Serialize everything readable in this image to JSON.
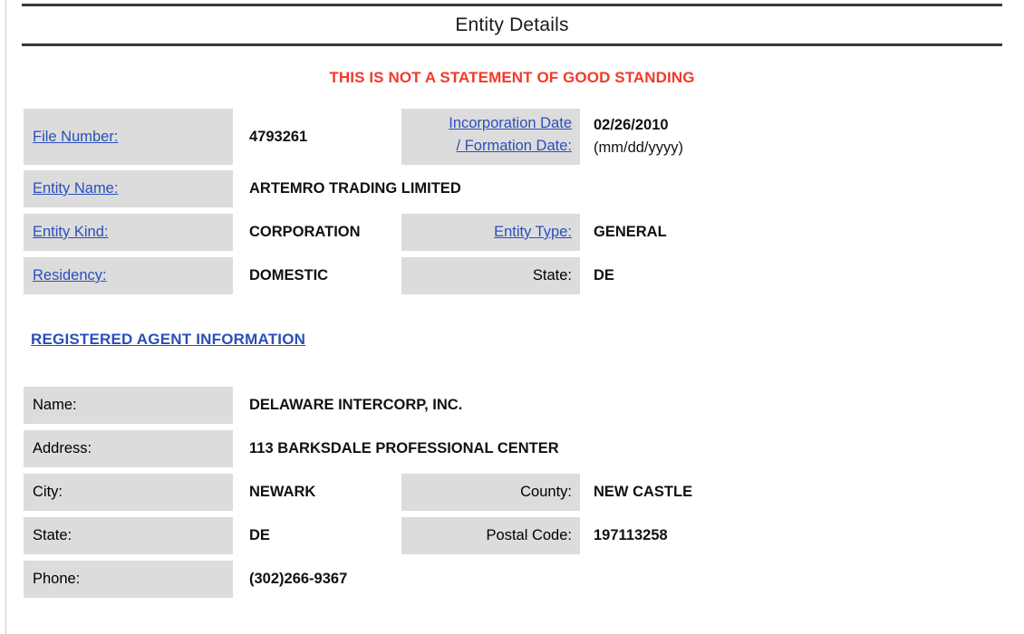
{
  "document": {
    "title": "Entity Details",
    "warning": "THIS IS NOT A STATEMENT OF GOOD STANDING",
    "warning_color": "#f23a28",
    "link_color": "#2a4fbb",
    "label_bg": "#dcdcdc"
  },
  "entity": {
    "file_number": {
      "label": "File Number:",
      "value": "4793261"
    },
    "incorporation_date": {
      "label_line1": "Incorporation Date",
      "label_line2": "/ Formation Date:",
      "value": "02/26/2010",
      "format_hint": "(mm/dd/yyyy)"
    },
    "entity_name": {
      "label": "Entity Name:",
      "value": "ARTEMRO TRADING LIMITED"
    },
    "entity_kind": {
      "label": "Entity Kind:",
      "value": "CORPORATION"
    },
    "entity_type": {
      "label": "Entity Type:",
      "value": "GENERAL"
    },
    "residency": {
      "label": "Residency:",
      "value": "DOMESTIC"
    },
    "state": {
      "label": "State:",
      "value": "DE"
    }
  },
  "registered_agent": {
    "section_title": "REGISTERED AGENT INFORMATION",
    "name": {
      "label": "Name:",
      "value": "DELAWARE INTERCORP, INC."
    },
    "address": {
      "label": "Address:",
      "value": "113 BARKSDALE PROFESSIONAL CENTER"
    },
    "city": {
      "label": "City:",
      "value": "NEWARK"
    },
    "county": {
      "label": "County:",
      "value": "NEW CASTLE"
    },
    "state": {
      "label": "State:",
      "value": "DE"
    },
    "postal_code": {
      "label": "Postal Code:",
      "value": "197113258"
    },
    "phone": {
      "label": "Phone:",
      "value": "(302)266-9367"
    }
  }
}
